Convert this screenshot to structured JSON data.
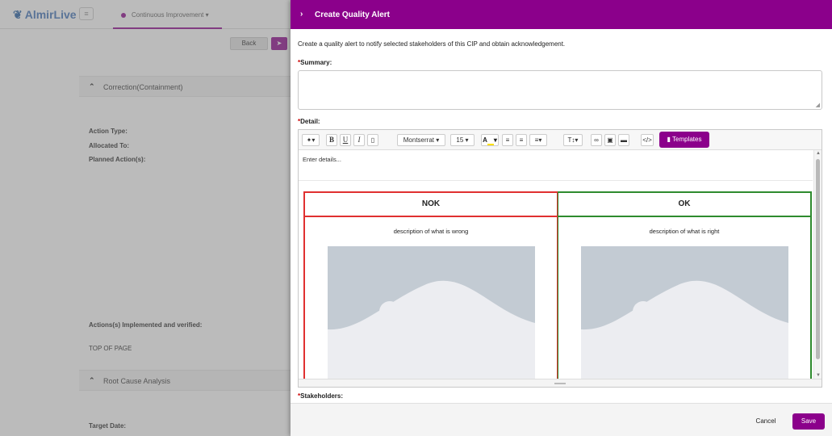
{
  "app": {
    "logo": "AlmirLive",
    "module": "Continuous Improvement"
  },
  "background": {
    "back_label": "Back",
    "sections": {
      "correction": "Correction(Containment)",
      "root_cause": "Root Cause Analysis"
    },
    "labels": {
      "action_type": "Action Type:",
      "allocated_to": "Allocated To:",
      "planned_actions": "Planned Action(s):",
      "implemented": "Actions(s) Implemented and verified:",
      "top_of_page": "TOP OF PAGE",
      "target_date": "Target Date:"
    }
  },
  "drawer": {
    "title": "Create Quality Alert",
    "intro": "Create a quality alert to notify selected stakeholders of this CIP and obtain acknowledgement.",
    "summary_label": "Summary:",
    "detail_label": "Detail:",
    "stakeholders_label": "Stakeholders:",
    "required_mark": "*",
    "toolbar": {
      "font_family": "Montserrat",
      "font_size": "15",
      "templates_label": "Templates"
    },
    "editor": {
      "placeholder": "Enter details...",
      "nok": {
        "heading": "NOK",
        "description": "description of what is wrong",
        "border_color": "#e03030"
      },
      "ok": {
        "heading": "OK",
        "description": "description of what is right",
        "border_color": "#2e8b2e"
      }
    },
    "footer": {
      "cancel_label": "Cancel",
      "save_label": "Save"
    }
  },
  "colors": {
    "accent": "#8b008b",
    "nok": "#e03030",
    "ok": "#2e8b2e"
  }
}
